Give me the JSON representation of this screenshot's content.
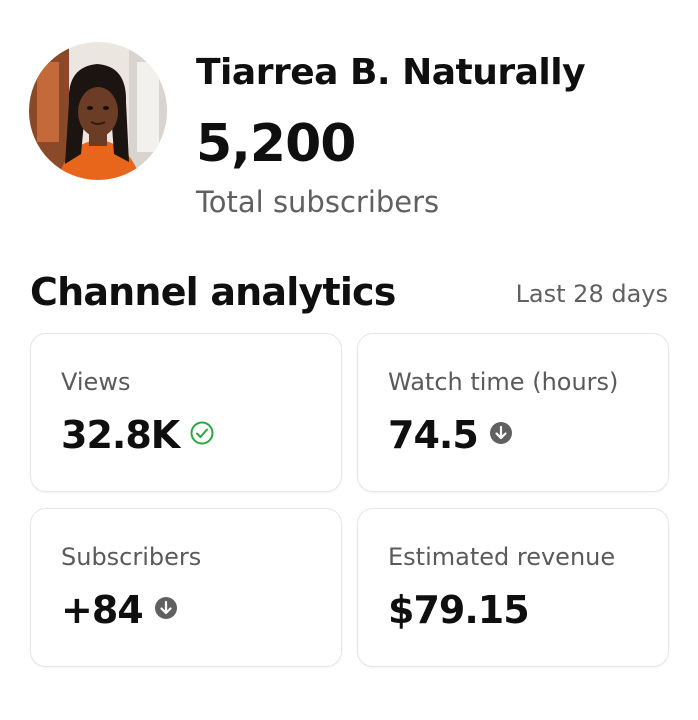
{
  "channel": {
    "name": "Tiarrea B. Naturally",
    "subscriber_count": "5,200",
    "subscriber_label": "Total subscribers"
  },
  "analytics": {
    "title": "Channel analytics",
    "range": "Last 28 days",
    "cards": [
      {
        "label": "Views",
        "value": "32.8K",
        "status_icon": "check-circle-icon",
        "status_color": "#2ba640"
      },
      {
        "label": "Watch time (hours)",
        "value": "74.5",
        "status_icon": "arrow-down-circle-icon",
        "status_color": "#606060"
      },
      {
        "label": "Subscribers",
        "value": "+84",
        "status_icon": "arrow-down-circle-icon",
        "status_color": "#606060"
      },
      {
        "label": "Estimated revenue",
        "value": "$79.15",
        "status_icon": null,
        "status_color": null
      }
    ]
  }
}
